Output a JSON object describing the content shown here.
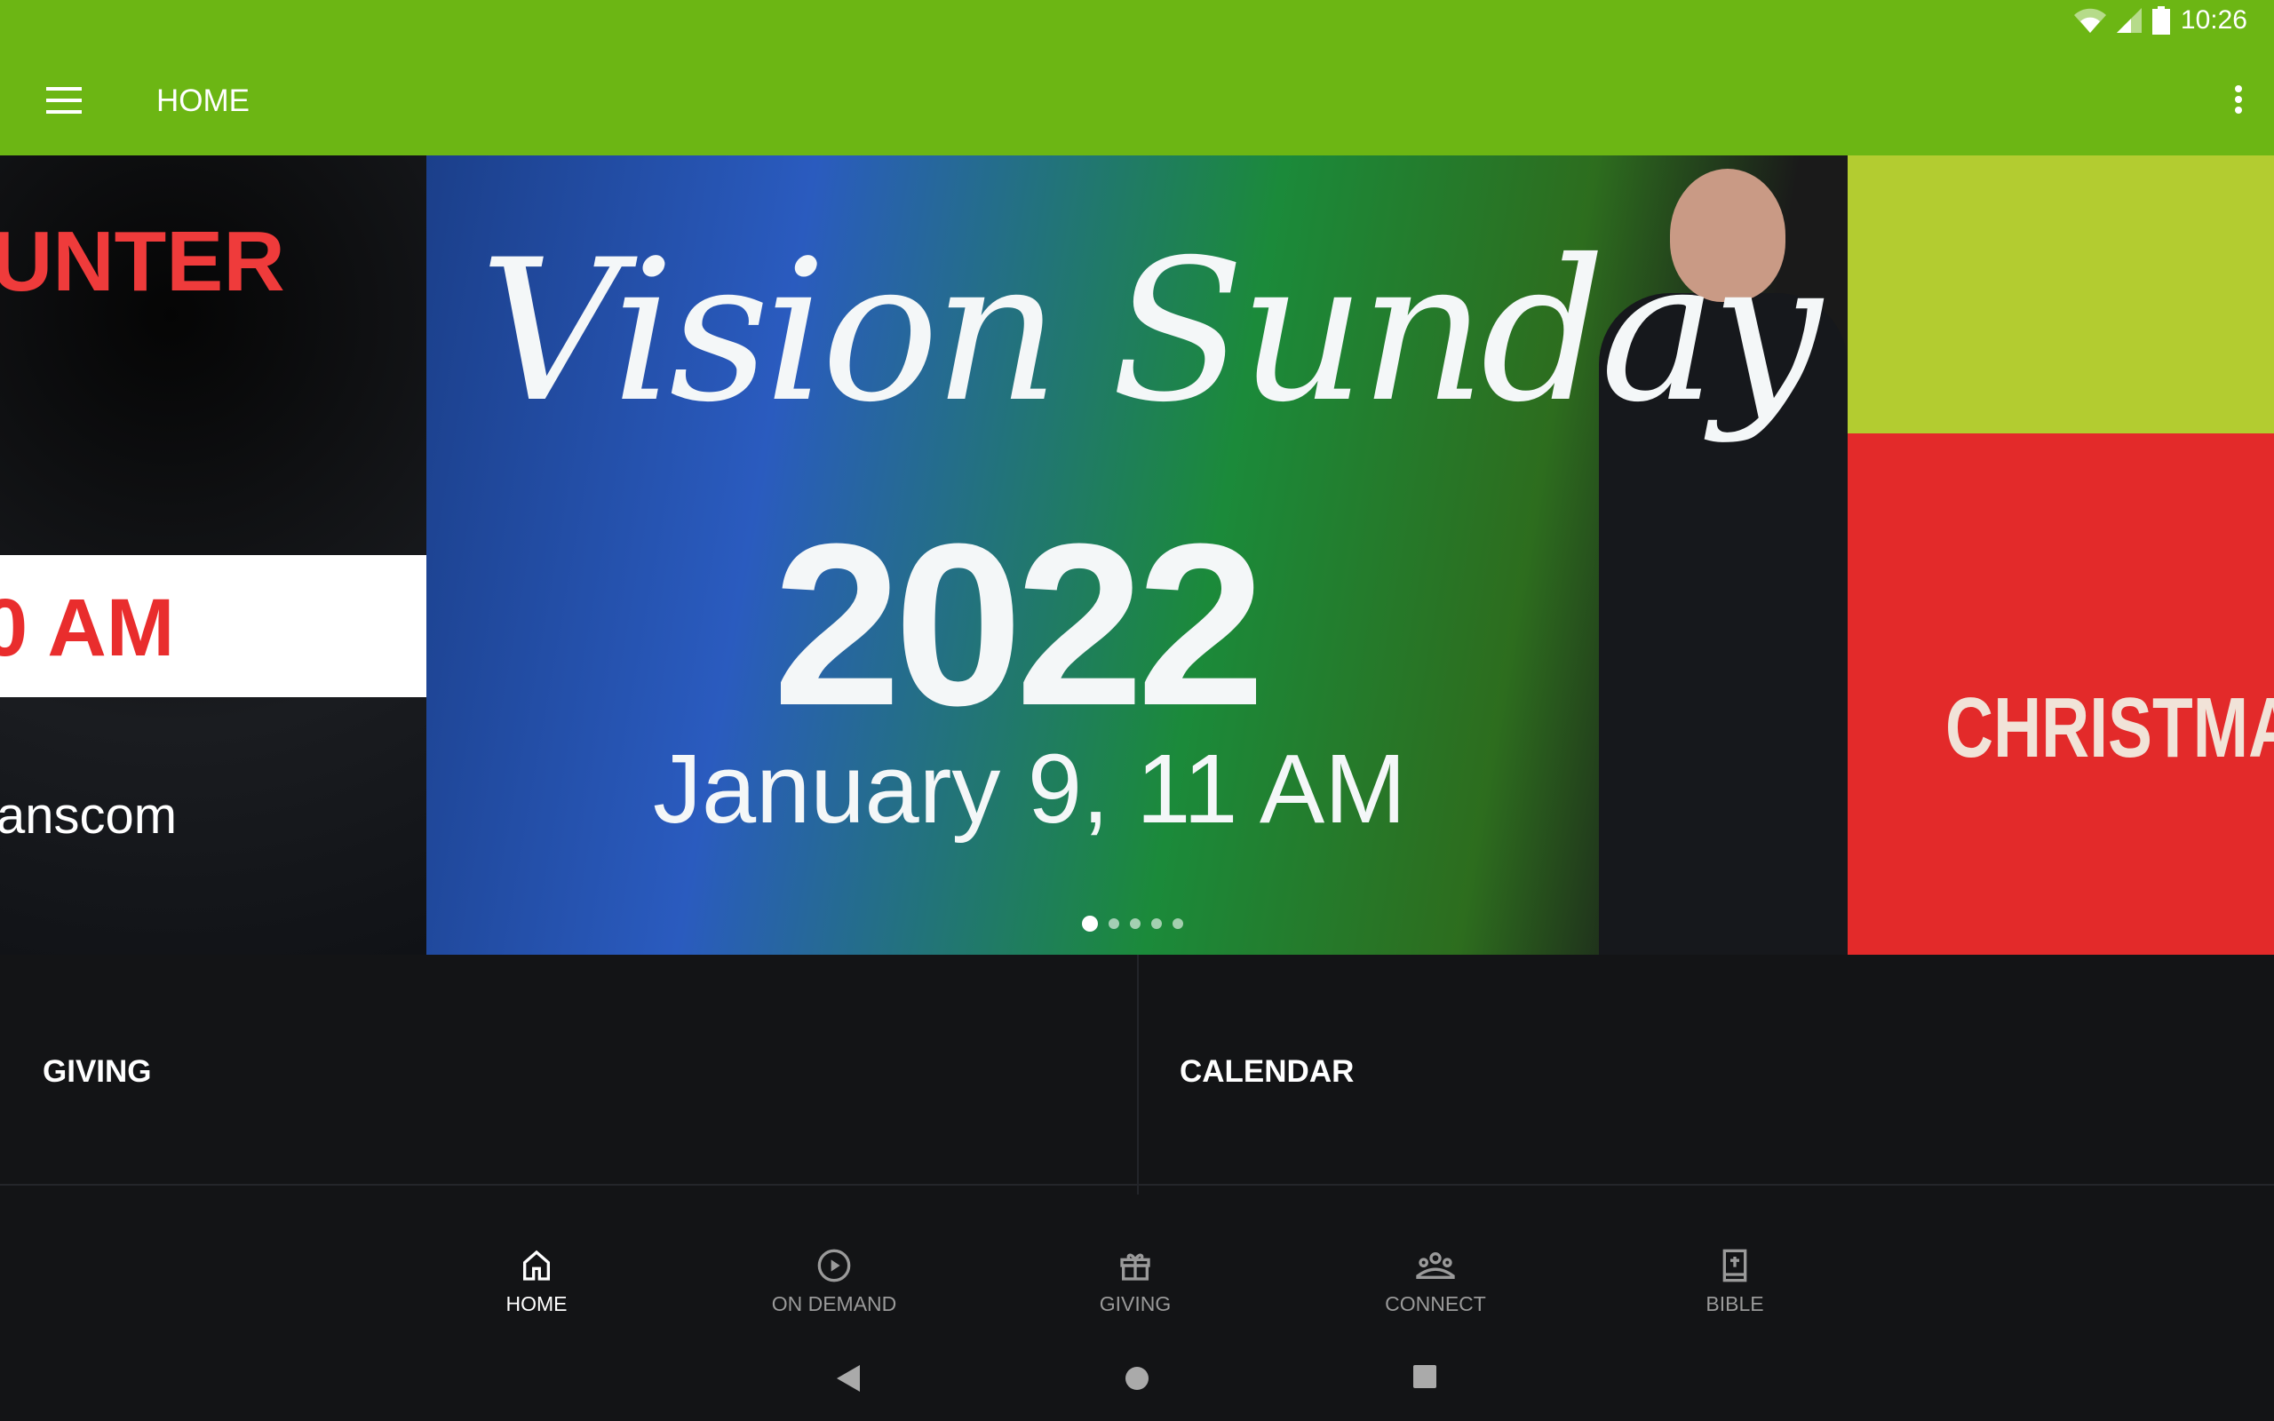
{
  "status_bar": {
    "time": "10:26",
    "icons": [
      "wifi-icon",
      "signal-icon",
      "battery-icon"
    ]
  },
  "app_bar": {
    "title": "HOME",
    "menu_icon": "hamburger-icon",
    "more_icon": "more-vert-icon",
    "color": "#6cb614"
  },
  "carousel": {
    "slides": [
      {
        "line1": "UNTER",
        "line2": "0 AM",
        "line3": "anscom"
      },
      {
        "title": "Vision Sunday",
        "year": "2022",
        "date": "January 9, 11 AM"
      },
      {
        "title": "CHRISTMAS"
      }
    ],
    "page_count": 5,
    "active_page": 1
  },
  "tiles": [
    {
      "label": "GIVING"
    },
    {
      "label": "CALENDAR"
    }
  ],
  "bottom_nav": [
    {
      "label": "HOME",
      "icon": "home-icon",
      "active": true
    },
    {
      "label": "ON DEMAND",
      "icon": "play-circle-icon"
    },
    {
      "label": "GIVING",
      "icon": "gift-icon"
    },
    {
      "label": "CONNECT",
      "icon": "group-icon"
    },
    {
      "label": "BIBLE",
      "icon": "bible-icon"
    }
  ]
}
